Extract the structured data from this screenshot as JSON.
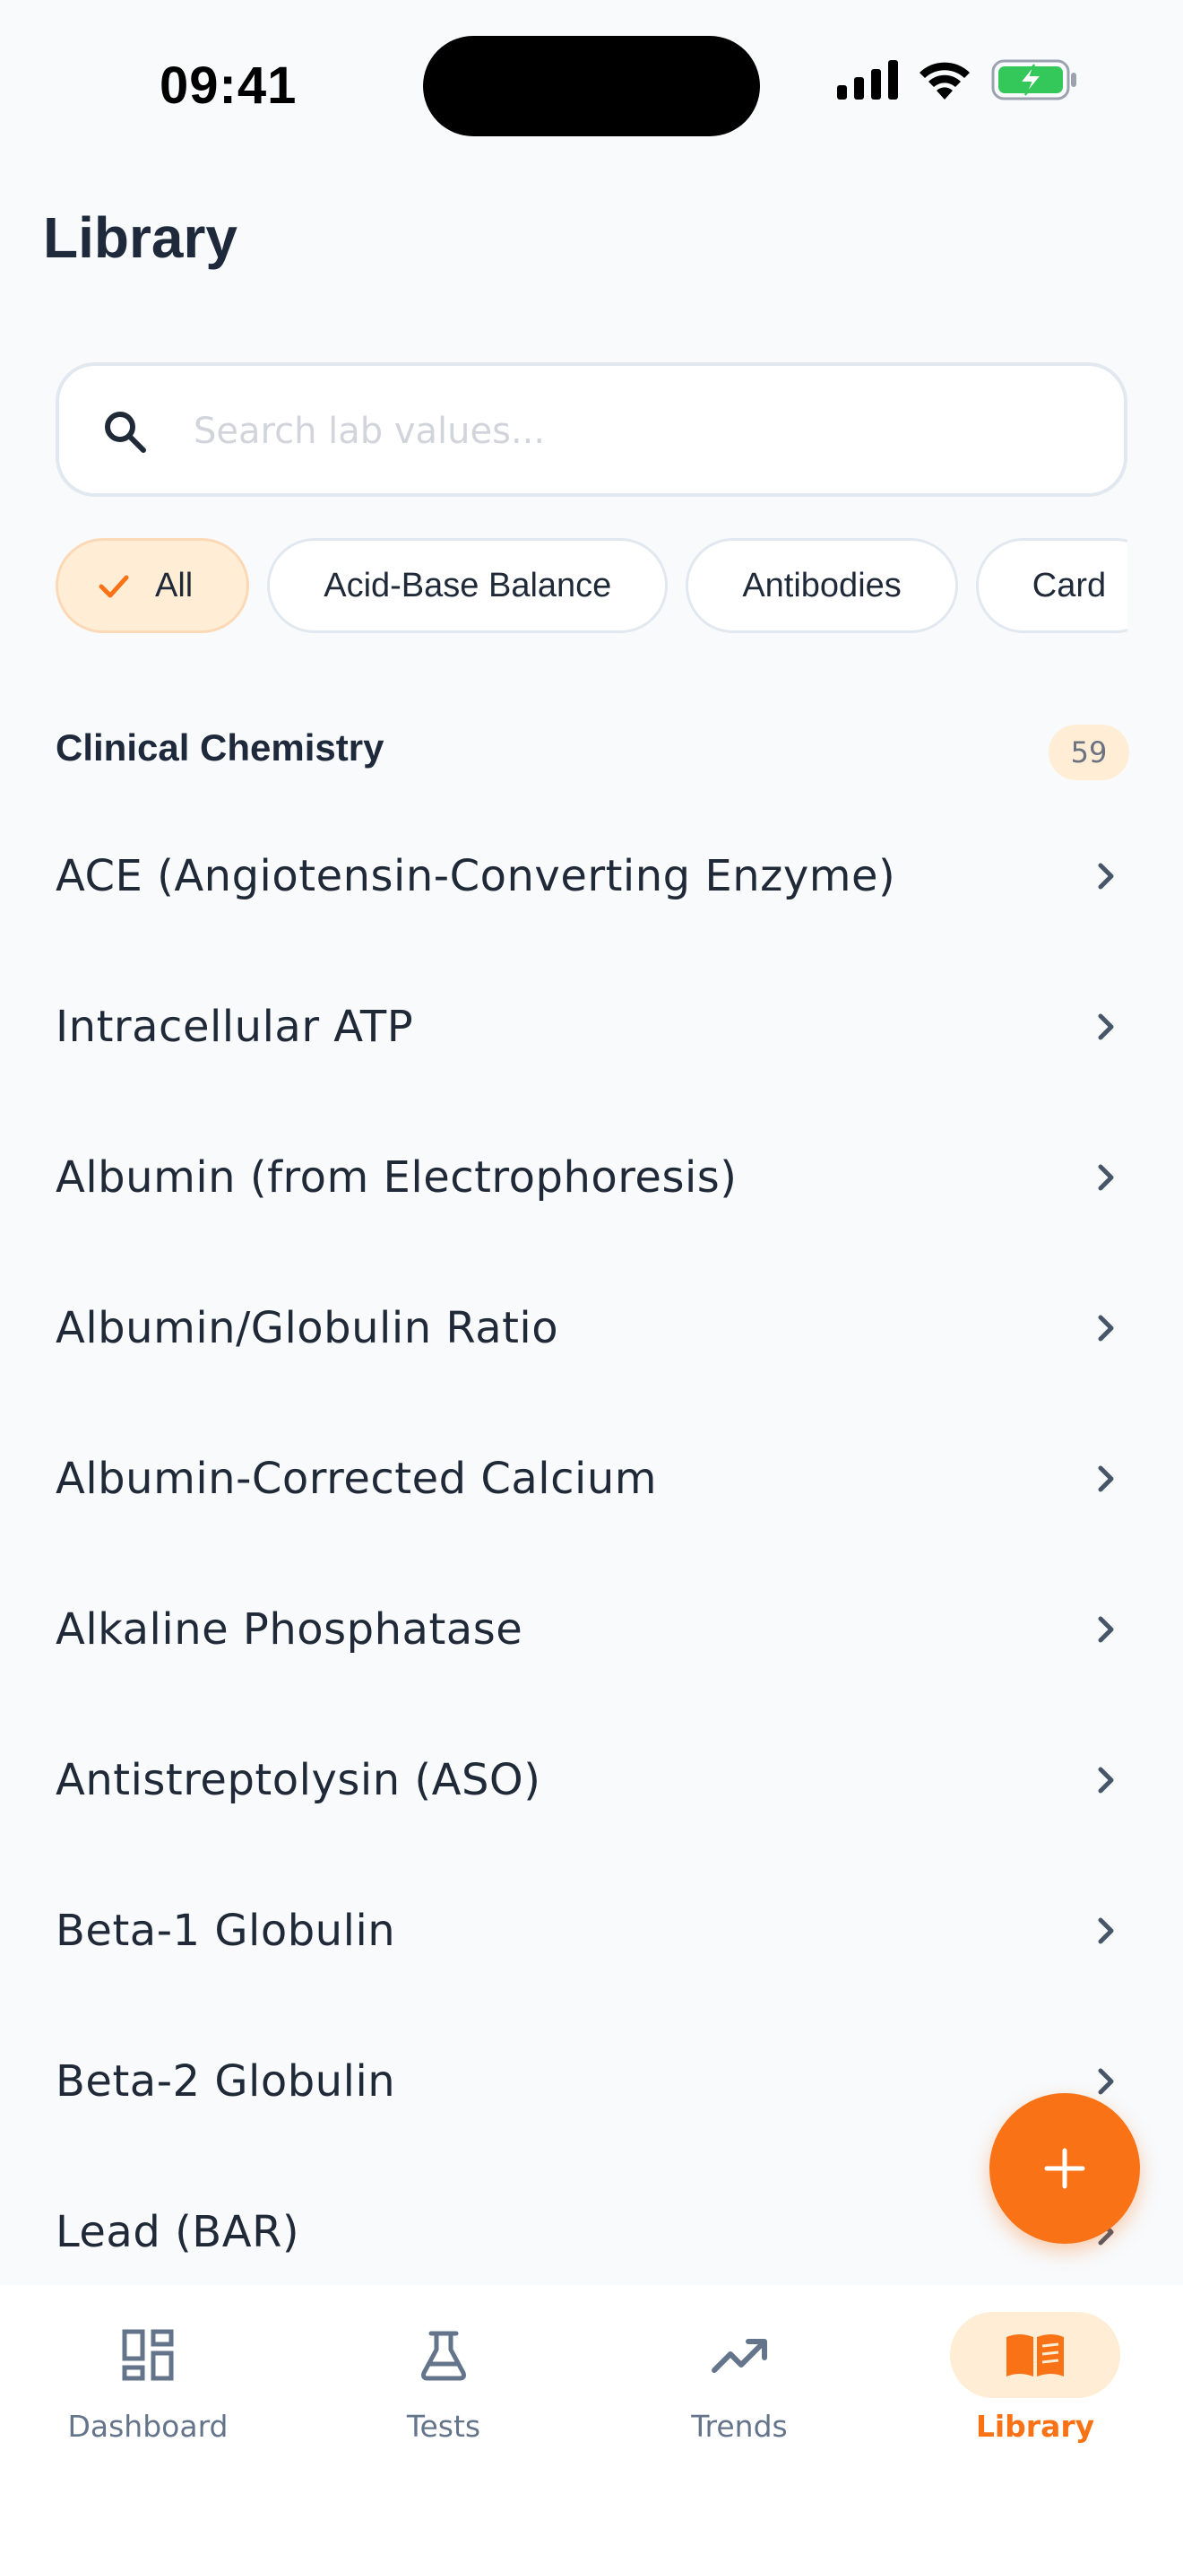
{
  "status_bar": {
    "time": "09:41"
  },
  "header": {
    "title": "Library"
  },
  "search": {
    "placeholder": "Search lab values..."
  },
  "filters": [
    {
      "label": "All",
      "selected": true
    },
    {
      "label": "Acid-Base Balance",
      "selected": false
    },
    {
      "label": "Antibodies",
      "selected": false
    },
    {
      "label": "Card",
      "selected": false
    }
  ],
  "section": {
    "title": "Clinical Chemistry",
    "count": "59"
  },
  "items": [
    "ACE (Angiotensin-Converting Enzyme)",
    "Intracellular ATP",
    "Albumin (from Electrophoresis)",
    "Albumin/Globulin Ratio",
    "Albumin-Corrected Calcium",
    "Alkaline Phosphatase",
    "Antistreptolysin (ASO)",
    "Beta-1 Globulin",
    "Beta-2 Globulin",
    "Lead (BAR)"
  ],
  "nav": [
    {
      "label": "Dashboard",
      "icon": "dashboard-icon",
      "active": false
    },
    {
      "label": "Tests",
      "icon": "flask-icon",
      "active": false
    },
    {
      "label": "Trends",
      "icon": "trending-up-icon",
      "active": false
    },
    {
      "label": "Library",
      "icon": "book-icon",
      "active": true
    }
  ],
  "colors": {
    "accent": "#f97316",
    "accent_light": "#ffedd5",
    "background": "#f8fafc",
    "text": "#1f2937",
    "muted": "#64748b"
  }
}
